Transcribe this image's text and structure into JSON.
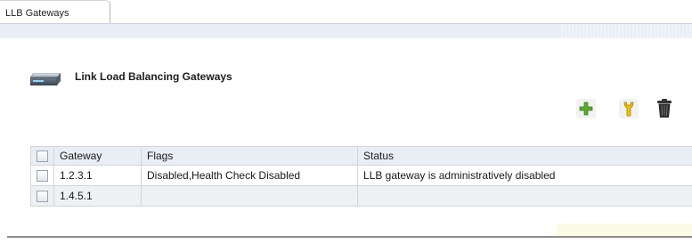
{
  "tab": {
    "label": "LLB Gateways"
  },
  "page": {
    "title": "Link Load Balancing Gateways",
    "icon": "server-appliance-icon"
  },
  "actions": {
    "add": {
      "icon": "add-icon",
      "color": "#5aa832"
    },
    "edit": {
      "icon": "wrench-icon",
      "color": "#e6b800"
    },
    "delete": {
      "icon": "trash-icon",
      "color": "#222222"
    }
  },
  "table": {
    "columns": [
      "Gateway",
      "Flags",
      "Status"
    ],
    "rows": [
      {
        "gateway": "1.2.3.1",
        "flags": "Disabled,Health Check Disabled",
        "status": "LLB gateway is administratively disabled"
      },
      {
        "gateway": "1.4.5.1",
        "flags": "",
        "status": ""
      }
    ]
  },
  "colors": {
    "header_bg": "#e9eef4",
    "border": "#cfd6dd",
    "strip": "#e8eef5"
  }
}
